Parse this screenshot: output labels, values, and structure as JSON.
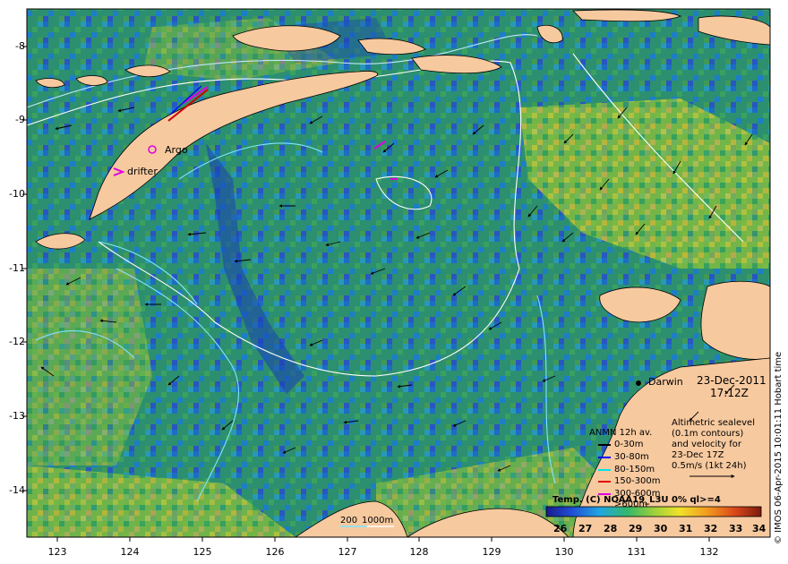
{
  "map": {
    "lat_labels": [
      "-8",
      "-9",
      "-10",
      "-11",
      "-12",
      "-13",
      "-14"
    ],
    "lon_labels": [
      "123",
      "124",
      "125",
      "126",
      "127",
      "128",
      "129",
      "130",
      "131",
      "132"
    ],
    "place_labels": {
      "argo": "Argo",
      "drifter": "drifter",
      "darwin": "Darwin"
    },
    "timestamp": {
      "date": "23-Dec-2011",
      "time": "17:12Z"
    },
    "altimetry_note": [
      "Altimetric sealevel",
      "(0.1m contours)",
      "and velocity for",
      "23-Dec 17Z",
      "0.5m/s (1kt 24h)"
    ],
    "anmn_legend": {
      "title": "ANMN 12h av.",
      "items": [
        {
          "label": "0-30m",
          "color": "#000000"
        },
        {
          "label": "30-80m",
          "color": "#0000ff"
        },
        {
          "label": "80-150m",
          "color": "#00e5e5"
        },
        {
          "label": "150-300m",
          "color": "#e00000"
        },
        {
          "label": "300-600m",
          "color": "#e000e0"
        },
        {
          "label": ">600m",
          "color": "#000000"
        }
      ]
    },
    "depth_labels": {
      "d200": "200",
      "d1000": "1000m"
    },
    "temp_title": "Temp. (C) NOAA19_L3U 0% ql>=4",
    "colorbar": {
      "ticks": [
        "26",
        "27",
        "28",
        "29",
        "30",
        "31",
        "32",
        "33",
        "34"
      ]
    },
    "credit": "© IMOS 06-Apr-2015 10:01:11 Hobart time"
  }
}
